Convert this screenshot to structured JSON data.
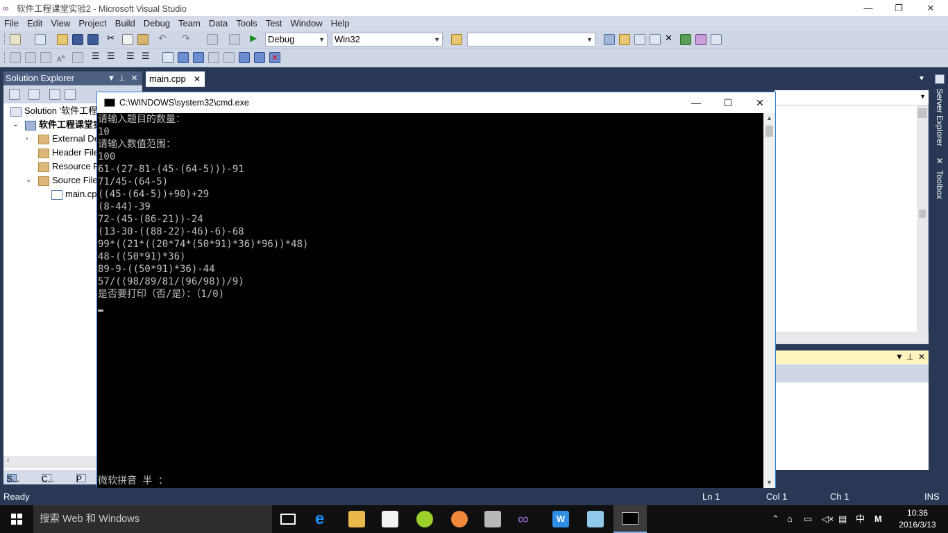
{
  "vs": {
    "title": "软件工程课堂实验2 - Microsoft Visual Studio",
    "menu": [
      "File",
      "Edit",
      "View",
      "Project",
      "Build",
      "Debug",
      "Team",
      "Data",
      "Tools",
      "Test",
      "Window",
      "Help"
    ],
    "config_combo": "Debug",
    "platform_combo": "Win32",
    "doc_tab": "main.cpp",
    "side_tabs": [
      "Server Explorer",
      "Toolbox"
    ]
  },
  "solution_explorer": {
    "title": "Solution Explorer",
    "items": [
      {
        "label": "Solution '软件工程"
      },
      {
        "label": "软件工程课堂实"
      },
      {
        "label": "External De"
      },
      {
        "label": "Header File"
      },
      {
        "label": "Resource F"
      },
      {
        "label": "Source File"
      },
      {
        "label": "main.cp"
      }
    ],
    "bottom_tabs": [
      "S...",
      "C...",
      "P"
    ]
  },
  "cmd": {
    "title": "C:\\WINDOWS\\system32\\cmd.exe",
    "lines": [
      "请输入题目的数量：",
      "10",
      "请输入数值范围：",
      "100",
      "61-(27-81-(45-(64-5)))-91",
      "71/45-(64-5)",
      "((45-(64-5))+90)+29",
      "(8-44)-39",
      "72-(45-(86-21))-24",
      "(13-30-((88-22)-46)-6)-68",
      "99*((21*((20*74*(50*91)*36)*96))*48)",
      "48-((50*91)*36)",
      "89-9-((50*91)*36)-44",
      "57/((98/89/81/(96/98))/9)",
      "是否要打印（否/是）：（1/0)"
    ],
    "ime_status": "微软拼音 半 ："
  },
  "status": {
    "ready": "Ready",
    "ln": "Ln 1",
    "col": "Col 1",
    "ch": "Ch 1",
    "ins": "INS"
  },
  "taskbar": {
    "search_placeholder": "搜索 Web 和 Windows",
    "ime_lang": "中",
    "ime_mode": "M",
    "time": "10:36",
    "date": "2016/3/13"
  }
}
